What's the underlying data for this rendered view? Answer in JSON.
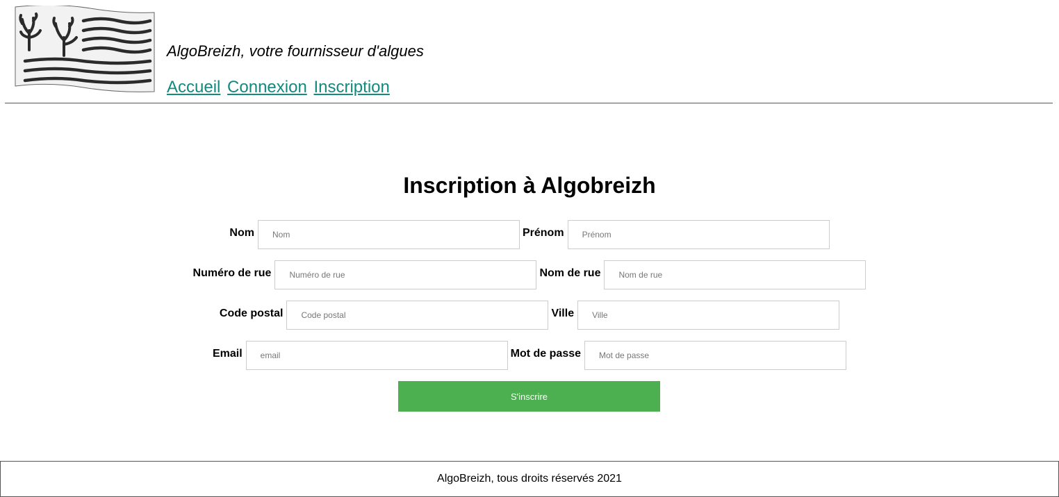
{
  "header": {
    "tagline": "AlgoBreizh, votre fournisseur d'algues",
    "nav": [
      "Accueil",
      "Connexion",
      "Inscription"
    ]
  },
  "form": {
    "title": "Inscription à Algobreizh",
    "fields": {
      "nom": {
        "label": "Nom",
        "placeholder": "Nom"
      },
      "prenom": {
        "label": "Prénom",
        "placeholder": "Prénom"
      },
      "numero_rue": {
        "label": "Numéro de rue",
        "placeholder": "Numéro de rue"
      },
      "nom_rue": {
        "label": "Nom de rue",
        "placeholder": "Nom de rue"
      },
      "code_postal": {
        "label": "Code postal",
        "placeholder": "Code postal"
      },
      "ville": {
        "label": "Ville",
        "placeholder": "Ville"
      },
      "email": {
        "label": "Email",
        "placeholder": "email"
      },
      "mot_de_passe": {
        "label": "Mot de passe",
        "placeholder": "Mot de passe"
      }
    },
    "submit_label": "S'inscrire"
  },
  "footer": {
    "text": "AlgoBreizh, tous droits réservés 2021"
  },
  "colors": {
    "link": "#128a80",
    "button": "#4caf50",
    "button_text": "#ffffff",
    "rule": "#555555",
    "logo_ink": "#2b2b2b",
    "logo_bg": "#f2f2f2"
  }
}
